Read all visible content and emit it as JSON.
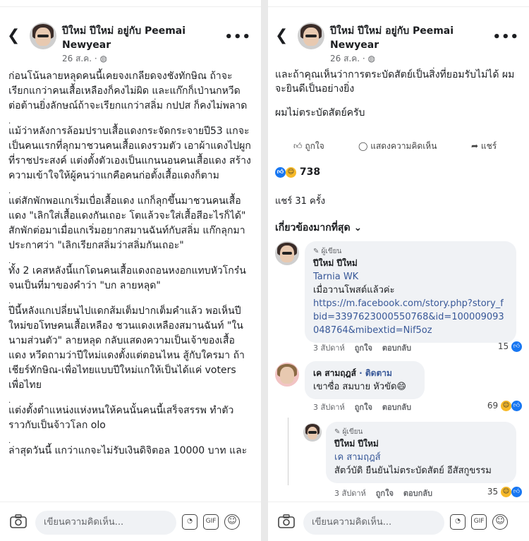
{
  "header": {
    "name": "ปีใหม่ ปีใหม่ อยู่กับ Peemai Newyear",
    "date": "26 ส.ค. · ◍"
  },
  "left_post": {
    "paragraphs": [
      "ก่อนโน้นลายหลุดคนนี้เคยจงเกลียดจงชังทักษิณ ถ้าจะเรียกแกว่าคนเสื้อเหลืองก็คงไม่ผิด และแก๊กก็เป่านกหวีดต่อต้านยิ่งลักษณ์ถ้าจะเรียกแกว่าสลิ่ม กปปส ก็คงไม่พลาด",
      "แม้ว่าหลังการล้อมปราบเสื้อแดงกระจัดกระจายปี53 แกจะเป็นคนแรกที่ลุกมาชวนคนเสื้อแดงรวมตัว เอาผ้าแดงไปผูกที่ราชประสงค์ แต่งตั้งตัวเองเป็นแกนนอนคนเสื้อแดง สร้างความเข้าใจให้ผู้คนว่าแกคือคนก่อตั้งเสื้อแดงก็ตาม",
      "แต่สักพักพอแกเริ่มเบื่อเสื้อแดง แกก็ลุกขึ้นมาชวนคนเสื้อแดง \"เลิกใส่เสื้อแดงกันเถอะ โตแล้วจะใส่เสื้อสีอะไรก็ได้\" สักพักต่อมาเมื่อแกเริ่มอยากสมานฉันท์กับสลิ่ม แก๊กลุกมาประกาศว่า \"เลิกเรียกสลิ่มว่าสลิ่มกันเถอะ\"",
      "ทั้ง 2 เคสหลังนี้แกโดนคนเสื้อแดงถอนหงอกแทบหัวโกร๋นจนเป็นที่มาของคำว่า \"บก ลายหลุด\"",
      "ปีนี้หลังแกเปลี่ยนไปแดกส้มเต็มปากเต็มคำแล้ว พอเห็นปีใหม่ขอโทษคนเสื้อเหลือง ชวนแดงเหลืองสมานฉันท์ \"ในนามส่วนตัว\" ลายหลุด กลับแสดงความเป็นเจ้าของเสื้อแดง หวีดถามว่าปีใหม่แดงตั้งแต่ตอนไหน สู้กับใครมา ถ้าเชียร์ทักษิณ-เพื่อไทยแบบปีใหม่แกให้เป็นได้แค่ voters เพื่อไทย",
      "แต่งตั้งตำแหน่งแห่งหนให้คนนั้นคนนี้เสร็จสรรพ ทำตัวราวกับเป็นจ้าวโลก olo",
      "ล่าสุดวันนี้ แกว่าแกจะไม่รับเงินดิจิตอล 10000 บาท และ"
    ],
    "dots": "."
  },
  "right_post": {
    "cut_line": "และถ้าคุณเห็นว่าการตระบัดสัตย์เป็นสิ่งที่ยอมรับไม่ได้ ผมจะยินดีเป็นอย่างยิ่ง",
    "last_line": "ผมไม่ตระบัดสัตย์ครับ"
  },
  "actions": {
    "like": "ถูกใจ",
    "comment": "แสดงความคิดเห็น",
    "share": "แชร์"
  },
  "reactions": {
    "count": "738"
  },
  "shares": "แชร์ 31 ครั้ง",
  "filter": "เกี่ยวข้องมากที่สุด ⌄",
  "comments": [
    {
      "badge": "✎ ผู้เขียน",
      "name": "ปีใหม่ ปีใหม่",
      "mention": "Tarnia WK",
      "text": "เมื่อวานโพสต์แล้วค่ะ",
      "link": "https://m.facebook.com/story.php?story_fbid=3397623000550768&id=100009093048764&mibextid=Nif5oz",
      "time": "3 สัปดาห์",
      "like": "ถูกใจ",
      "reply": "ตอบกลับ",
      "count": "15"
    },
    {
      "name": "เค สามฤฎส์",
      "follow": "· ติดตาม",
      "text": "เขาซื่อ สมบาย หัวขัด😄",
      "time": "3 สัปดาห์",
      "like": "ถูกใจ",
      "reply": "ตอบกลับ",
      "count": "69"
    },
    {
      "badge": "✎ ผู้เขียน",
      "name": "ปีใหม่ ปีใหม่",
      "mention": "เค สามฤฎส์",
      "text": "สัตว์บัดิ ยืนยันไม่ตระบัดสัตย์ อีสัสกูขรรม",
      "time": "3 สัปดาห์",
      "like": "ถูกใจ",
      "reply": "ตอบกลับ",
      "count": "35"
    }
  ],
  "composer": {
    "placeholder": "เขียนความคิดเห็น...",
    "gif": "GIF"
  }
}
